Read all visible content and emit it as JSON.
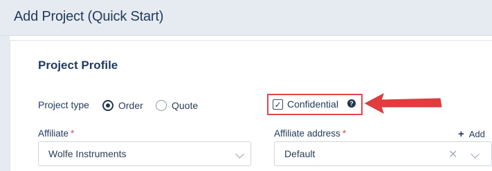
{
  "header": {
    "title": "Add Project (Quick Start)"
  },
  "section": {
    "title": "Project Profile"
  },
  "project_type": {
    "label": "Project type",
    "options": [
      {
        "label": "Order",
        "selected": true
      },
      {
        "label": "Quote",
        "selected": false
      }
    ]
  },
  "confidential": {
    "label": "Confidential",
    "checked": true,
    "help_icon": "question-circle-icon"
  },
  "affiliate": {
    "label": "Affiliate",
    "required_mark": "*",
    "value": "Wolfe Instruments"
  },
  "affiliate_address": {
    "label": "Affiliate address",
    "required_mark": "*",
    "value": "Default"
  },
  "add_link": {
    "icon": "plus-icon",
    "label": "Add"
  },
  "colors": {
    "accent": "#1f3a5c",
    "highlight": "#e0464b",
    "header_bg": "#e6ebf1"
  }
}
